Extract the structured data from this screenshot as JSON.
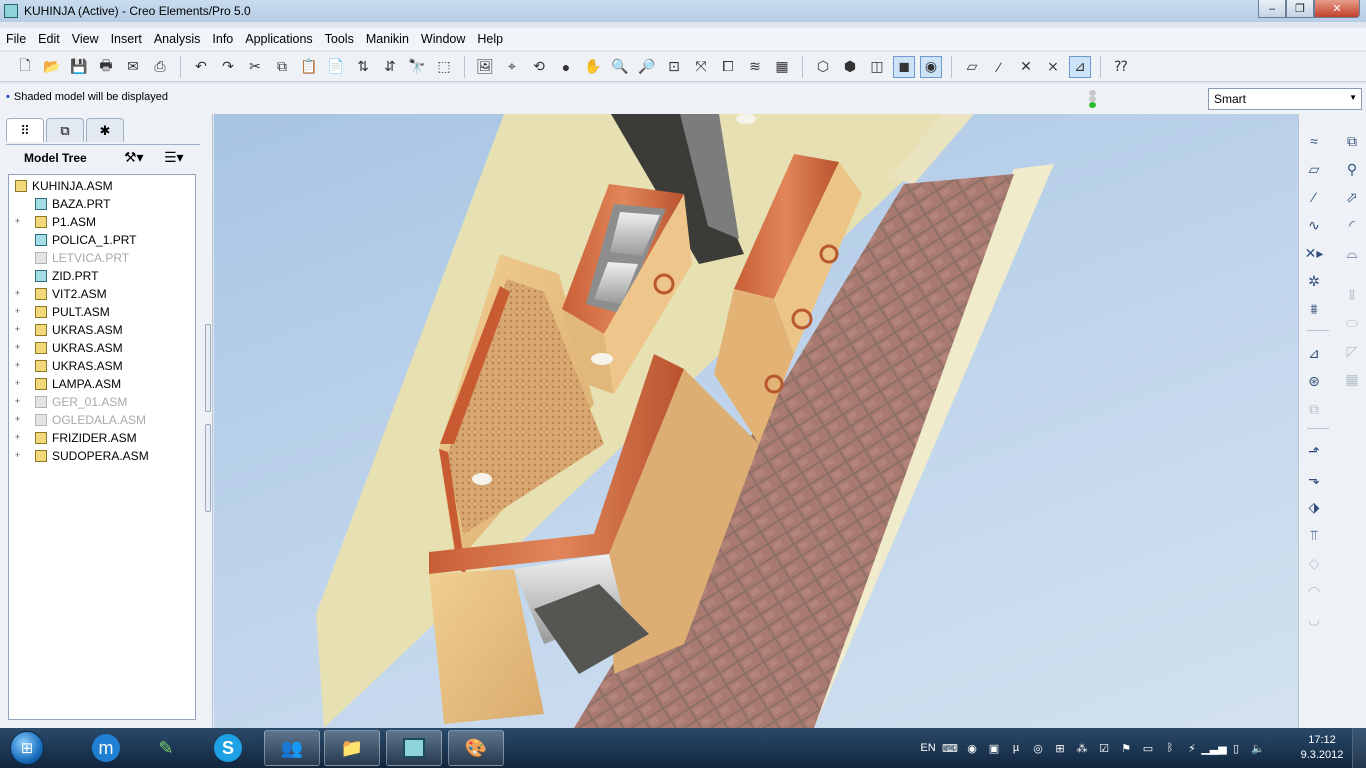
{
  "window": {
    "title": "KUHINJA (Active) - Creo Elements/Pro 5.0",
    "controls": [
      "–",
      "❐",
      "✕"
    ]
  },
  "menu": [
    "File",
    "Edit",
    "View",
    "Insert",
    "Analysis",
    "Info",
    "Applications",
    "Tools",
    "Manikin",
    "Window",
    "Help"
  ],
  "status": {
    "message": "Shaded model will be displayed",
    "filter": "Smart"
  },
  "model_tree": {
    "label": "Model Tree",
    "root": "KUHINJA.ASM",
    "items": [
      {
        "name": "BAZA.PRT",
        "type": "part",
        "expandable": false,
        "suppressed": false
      },
      {
        "name": "P1.ASM",
        "type": "asm",
        "expandable": true,
        "suppressed": false
      },
      {
        "name": "POLICA_1.PRT",
        "type": "part",
        "expandable": false,
        "suppressed": false
      },
      {
        "name": "LETVICA.PRT",
        "type": "part",
        "expandable": false,
        "suppressed": true
      },
      {
        "name": "ZID.PRT",
        "type": "part",
        "expandable": false,
        "suppressed": false
      },
      {
        "name": "VIT2.ASM",
        "type": "asm",
        "expandable": true,
        "suppressed": false
      },
      {
        "name": "PULT.ASM",
        "type": "asm",
        "expandable": true,
        "suppressed": false
      },
      {
        "name": "UKRAS.ASM",
        "type": "asm",
        "expandable": true,
        "suppressed": false
      },
      {
        "name": "UKRAS.ASM",
        "type": "asm",
        "expandable": true,
        "suppressed": false
      },
      {
        "name": "UKRAS.ASM",
        "type": "asm",
        "expandable": true,
        "suppressed": false
      },
      {
        "name": "LAMPA.ASM",
        "type": "asm",
        "expandable": true,
        "suppressed": false
      },
      {
        "name": "GER_01.ASM",
        "type": "asm",
        "expandable": true,
        "suppressed": true
      },
      {
        "name": "OGLEDALA.ASM",
        "type": "asm",
        "expandable": true,
        "suppressed": true
      },
      {
        "name": "FRIZIDER.ASM",
        "type": "asm",
        "expandable": true,
        "suppressed": false
      },
      {
        "name": "SUDOPERA.ASM",
        "type": "asm",
        "expandable": true,
        "suppressed": false
      }
    ]
  },
  "taskbar": {
    "language": "EN",
    "time": "17:12",
    "date": "9.3.2012"
  }
}
